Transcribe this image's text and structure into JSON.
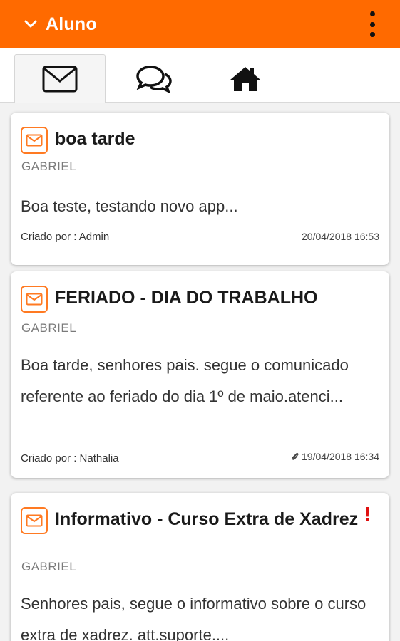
{
  "appbar": {
    "title": "Aluno"
  },
  "tabs": [
    "messages",
    "chat",
    "home"
  ],
  "messages": [
    {
      "title": "boa tarde",
      "sender": "GABRIEL",
      "body": "Boa teste, testando novo app...",
      "author": "Criado por : Admin",
      "date": "20/04/2018 16:53"
    },
    {
      "title": "FERIADO - DIA DO TRABALHO",
      "sender": "GABRIEL",
      "body": "Boa tarde, senhores pais. segue o comunicado referente ao feriado do dia 1º de maio.atenci...",
      "author": "Criado por : Nathalia",
      "date": "19/04/2018 16:34",
      "attachment": true
    },
    {
      "title": "Informativo - Curso Extra de Xadrez",
      "sender": "GABRIEL",
      "body": "Senhores pais, segue o informativo sobre o curso extra de xadrez. att.suporte....",
      "important_mark": "!"
    }
  ],
  "colors": {
    "accent": "#ff6a00",
    "alert": "#e01010"
  }
}
